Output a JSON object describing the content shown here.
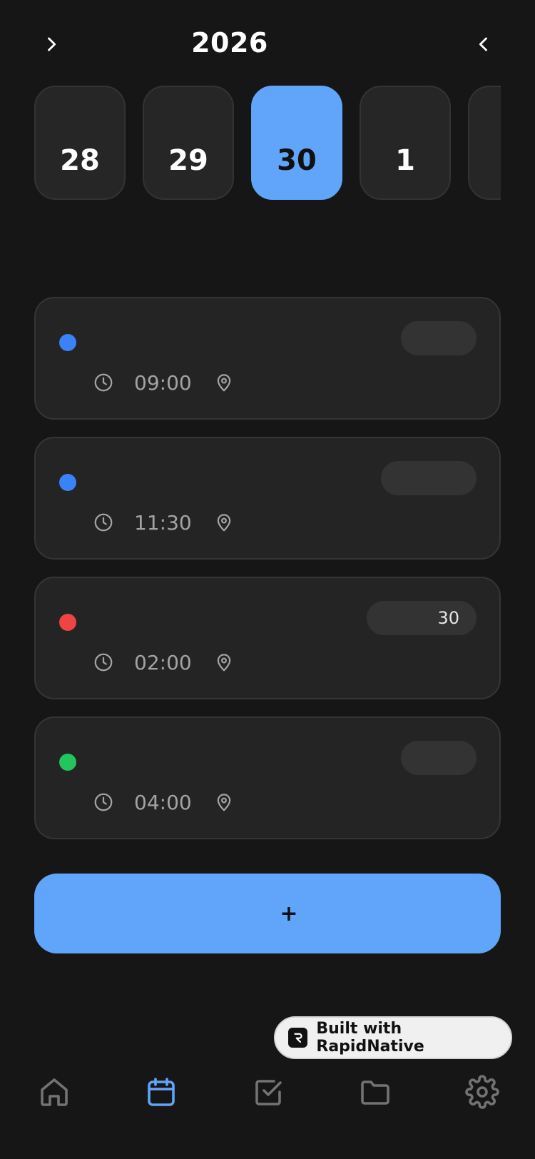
{
  "header": {
    "year": "2026",
    "left_icon": "chevron-right-icon",
    "right_icon": "chevron-left-icon"
  },
  "days": [
    {
      "label": "28",
      "selected": false
    },
    {
      "label": "29",
      "selected": false
    },
    {
      "label": "30",
      "selected": true
    },
    {
      "label": "1",
      "selected": false
    },
    {
      "label": "",
      "selected": false
    }
  ],
  "events": [
    {
      "time": "09:00",
      "pill": "",
      "dot_color": "#3b82f6"
    },
    {
      "time": "11:30",
      "pill": "",
      "dot_color": "#3b82f6"
    },
    {
      "time": "02:00",
      "pill": "30",
      "dot_color": "#ef4444"
    },
    {
      "time": "04:00",
      "pill": "",
      "dot_color": "#22c55e"
    }
  ],
  "add_button": {
    "label": "+"
  },
  "badge": {
    "text": "Built with RapidNative",
    "icon": "rapidnative-logo-icon"
  },
  "nav": {
    "items": [
      {
        "icon": "home-icon",
        "active": false
      },
      {
        "icon": "calendar-icon",
        "active": true
      },
      {
        "icon": "checkbox-icon",
        "active": false
      },
      {
        "icon": "folder-icon",
        "active": false
      },
      {
        "icon": "gear-icon",
        "active": false
      }
    ]
  },
  "colors": {
    "background": "#161616",
    "card": "#242424",
    "accent": "#60a5fa",
    "nav_inactive": "#737373"
  }
}
